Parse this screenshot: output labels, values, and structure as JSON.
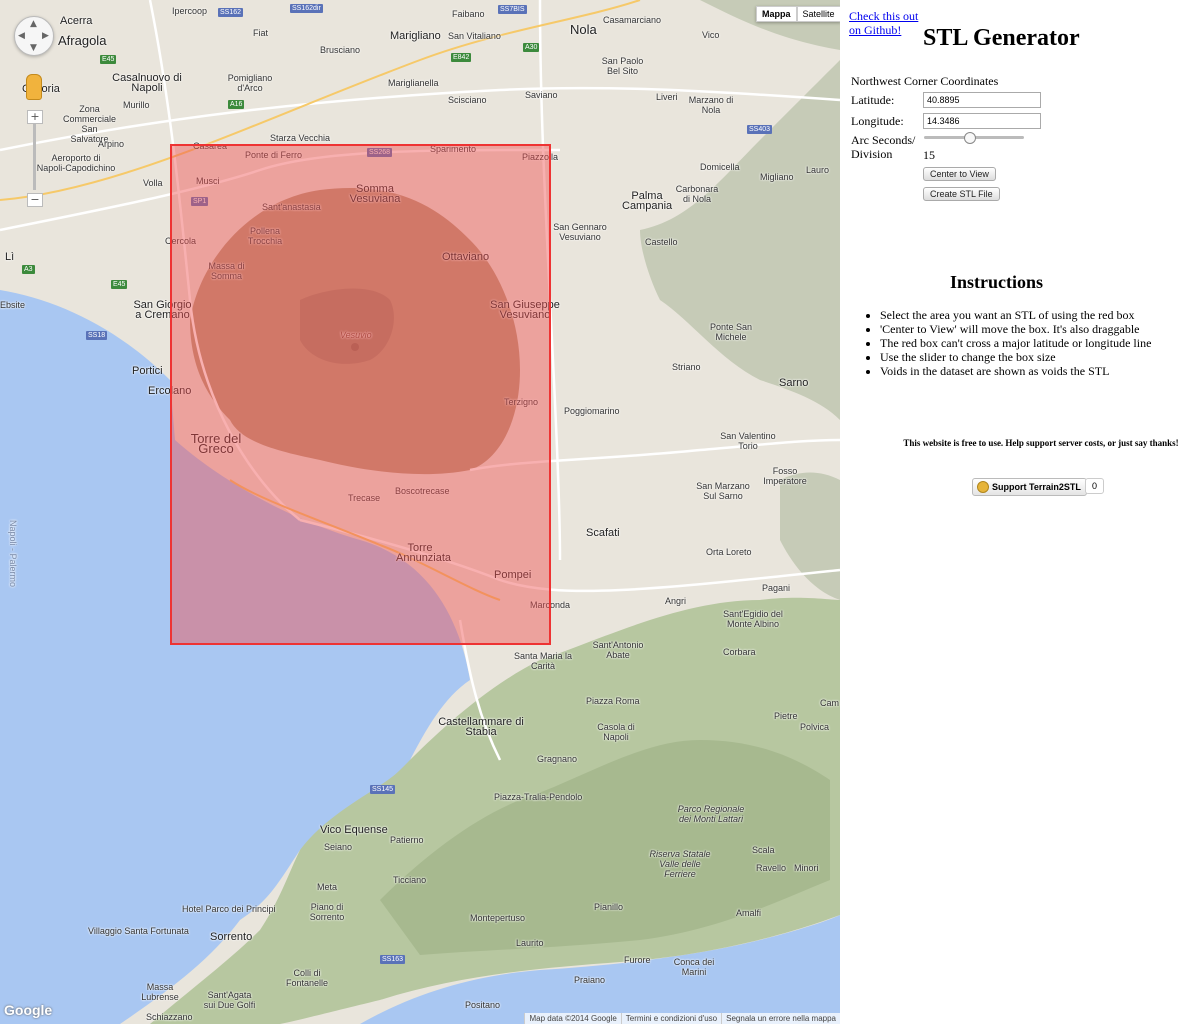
{
  "map": {
    "map_types": [
      {
        "label": "Mappa",
        "active": true
      },
      {
        "label": "Satellite",
        "active": false
      }
    ],
    "zoom_in": "+",
    "zoom_out": "−",
    "logo": "Google",
    "attribution": [
      "Map data ©2014 Google",
      "Termini e condizioni d'uso",
      "Segnala un errore nella mappa"
    ],
    "places": [
      "Ipercoop",
      "Fiat",
      "Faibano",
      "Marigliano",
      "Nola",
      "Casamarciano",
      "Afragola",
      "Casalnuovo di Napoli",
      "Pomigliano d'Arco",
      "Brusciano",
      "San Vitaliano",
      "Saviano",
      "San Paolo Bel Sito",
      "Vico",
      "Acerra",
      "Murillo",
      "Zona Commerciale San Salvatore",
      "Arpino",
      "Casoria",
      "Starza Vecchia",
      "Mariglianella",
      "Scisciano",
      "Liveri",
      "Marzano di Nola",
      "Aeroporto di Napoli-Capodichino",
      "Volla",
      "Casarea",
      "Ponte di Ferro",
      "Sparimento",
      "Piazzolla",
      "Domicella",
      "Migliano",
      "Lauro",
      "Musci",
      "Somma Vesuviana",
      "Palma Campania",
      "Carbonara di Nola",
      "Cercola",
      "Sant'anastasia",
      "Pollena Trocchia",
      "San Gennaro Vesuviano",
      "Castello",
      "Massa di Somma",
      "Ottaviano",
      "San Giorgio a Cremano",
      "San Giuseppe Vesuviano",
      "Ponte San Michele",
      "Vesuvio",
      "Portici",
      "Striano",
      "Sarno",
      "Ercolano",
      "Terzigno",
      "Poggiomarino",
      "Torre del Greco",
      "San Valentino Torio",
      "Fosso Imperatore",
      "Boscotrecase",
      "Trecase",
      "San Marzano Sul Sarno",
      "Torre Annunziata",
      "Scafati",
      "Orta Loreto",
      "Pompei",
      "Angri",
      "Pagani",
      "Marconda",
      "Sant'Egidio del Monte Albino",
      "Sant'Antonio Abate",
      "Santa Maria la Carità",
      "Corbara",
      "Piazza Roma",
      "Castellammare di Stabia",
      "Casola di Napoli",
      "Gragnano",
      "Pietre",
      "Piazza-Tralia-Pendolo",
      "Parco Regionale dei Monti Lattari",
      "Vico Equense",
      "Riserva Statale Valle delle Ferriere",
      "Patierno",
      "Scala",
      "Seiano",
      "Ravello",
      "Minori",
      "Meta",
      "Ticciano",
      "Hotel Parco dei Principi",
      "Sorrento",
      "Piano di Sorrento",
      "Montepertuso",
      "Pianillo",
      "Amalfi",
      "Villaggio Santa Fortunata",
      "Laurito",
      "Praiano",
      "Furore",
      "Conca dei Marini",
      "Massa Lubrense",
      "Sant'Agata sui Due Golfi",
      "Colli di Fontanelle",
      "Schiazzano",
      "Positano",
      "Ebsite",
      "Lì",
      "Polvica",
      "Cam",
      "Napoli - Palermo"
    ],
    "roads": [
      "SS162",
      "SS162dir",
      "E45",
      "E842",
      "A30",
      "A16",
      "SS7BIS",
      "SS268",
      "SP1",
      "SS403",
      "A3",
      "SS18",
      "SS145",
      "SS163",
      "E45"
    ]
  },
  "panel": {
    "github_link": "Check this out on Github!",
    "title": "STL Generator",
    "nw_label": "Northwest Corner Coordinates",
    "lat_label": "Latitude:",
    "lat_value": "40.8895",
    "lon_label": "Longitude:",
    "lon_value": "14.3486",
    "arc_label": "Arc Seconds/ Division",
    "arc_value": "15",
    "arc_fraction": 0.45,
    "center_button": "Center to View",
    "create_button": "Create STL File",
    "instructions_title": "Instructions",
    "instructions": [
      "Select the area you want an STL of using the red box",
      "'Center to View' will move the box. It's also draggable",
      "The red box can't cross a major latitude or longitude line",
      "Use the slider to change the box size",
      "Voids in the dataset are shown as voids the STL"
    ],
    "support_text": "This website is free to use. Help support server costs, or just say thanks!",
    "support_button": "Support Terrain2STL",
    "support_count": "0"
  }
}
